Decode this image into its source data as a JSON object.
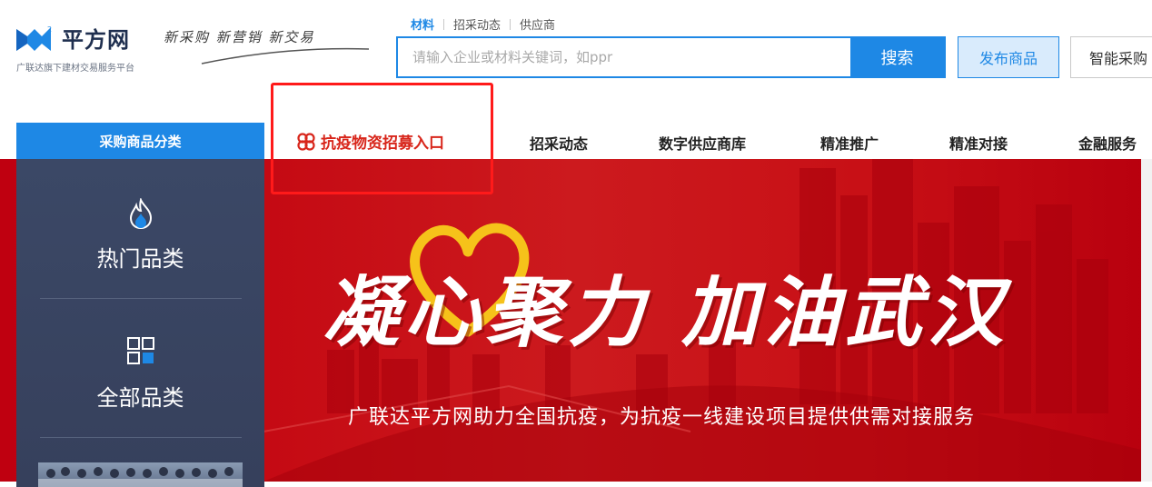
{
  "header": {
    "logo_name": "平方网",
    "logo_sub": "广联达旗下建材交易服务平台",
    "slogan": "新采购 新营销 新交易",
    "search_tabs": [
      {
        "label": "材料",
        "active": true
      },
      {
        "label": "招采动态",
        "active": false
      },
      {
        "label": "供应商",
        "active": false
      }
    ],
    "search": {
      "placeholder": "请输入企业或材料关键词，如ppr",
      "button_label": "搜索"
    },
    "publish_label": "发布商品",
    "smart_label": "智能采购"
  },
  "nav": {
    "category_header": "采购商品分类",
    "promo_label": "抗疫物资招募入口",
    "items": [
      "招采动态",
      "数字供应商库",
      "精准推广",
      "精准对接",
      "金融服务"
    ]
  },
  "sidebar": {
    "categories": [
      {
        "label": "热门品类",
        "icon": "flame-icon"
      },
      {
        "label": "全部品类",
        "icon": "grid-icon"
      }
    ]
  },
  "banner": {
    "title": "凝心聚力 加油武汉",
    "caption": "广联达平方网助力全国抗疫，为抗疫一线建设项目提供供需对接服务"
  },
  "colors": {
    "brand_blue": "#1e88e5",
    "promo_red": "#d8261b",
    "banner_red": "#c40812",
    "sidebar_navy": "#3b4866",
    "highlight_red": "#ff1a1a"
  }
}
